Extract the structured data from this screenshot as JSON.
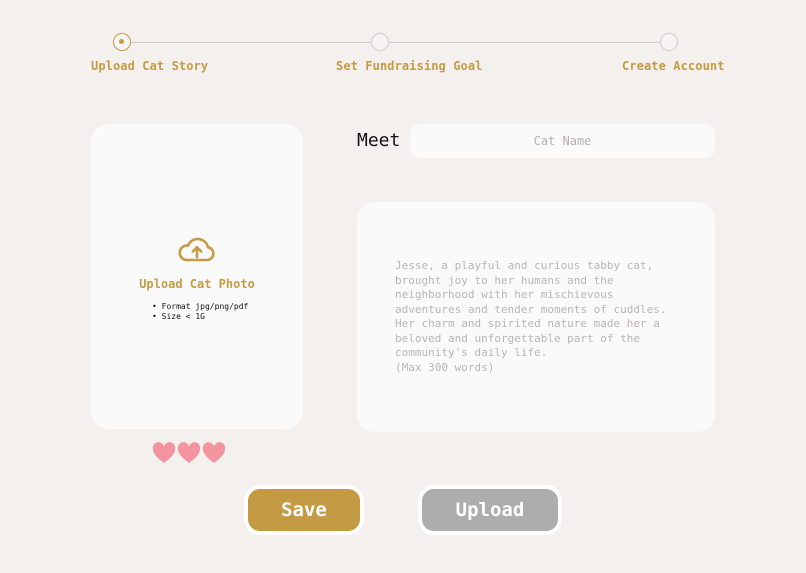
{
  "steps": [
    {
      "label": "Upload Cat Story",
      "active": true
    },
    {
      "label": "Set Fundraising Goal",
      "active": false
    },
    {
      "label": "Create Account",
      "active": false
    }
  ],
  "photo_upload": {
    "title": "Upload Cat Photo",
    "icon": "cloud-upload-icon",
    "specs": [
      "Format jpg/png/pdf",
      "Size < 1G"
    ]
  },
  "hearts": {
    "icon": "heart-icon",
    "count": 3,
    "color": "#f4949e"
  },
  "name_field": {
    "label": "Meet",
    "placeholder": "Cat Name",
    "value": ""
  },
  "story_field": {
    "placeholder": "Jesse, a playful and curious tabby cat,\nbrought joy to her humans and the\nneighborhood with her mischievous\nadventures and tender moments of cuddles.\nHer charm and spirited nature made her a\nbeloved and unforgettable part of the\ncommunity's daily life.\n(Max 300 words)",
    "value": ""
  },
  "buttons": {
    "save": "Save",
    "upload": "Upload"
  },
  "colors": {
    "accent": "#c59a45",
    "disabled": "#adadad",
    "background": "#f3f0ee",
    "card": "#fafafa"
  }
}
